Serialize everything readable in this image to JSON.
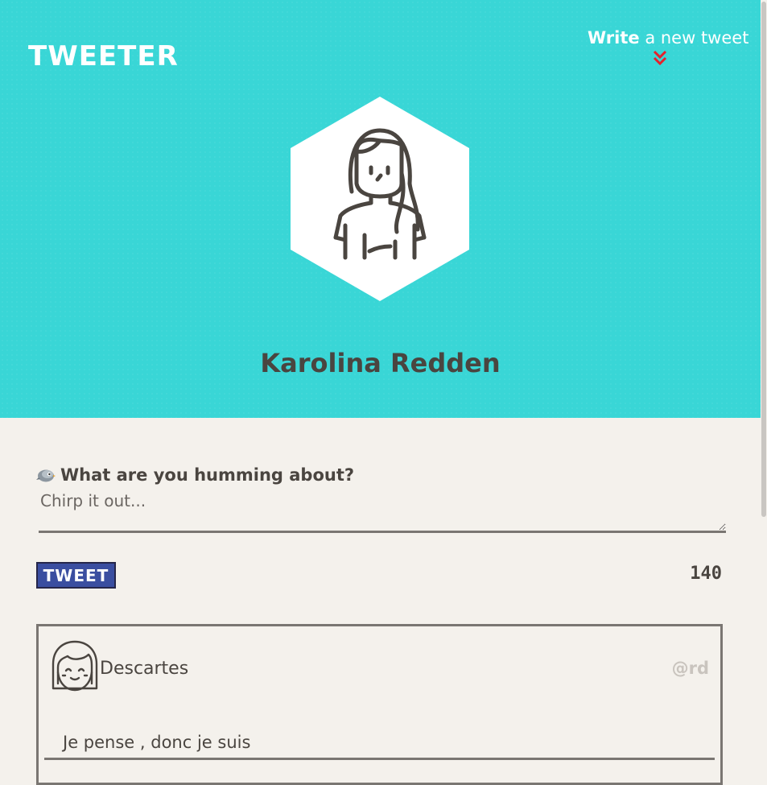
{
  "header": {
    "brand": "TWEETER",
    "compose_toggle": {
      "bold": "Write",
      "rest": " a new tweet",
      "icon": "double-chevron-down-icon"
    }
  },
  "profile": {
    "name": "Karolina Redden",
    "avatar_icon": "woman-avatar-icon"
  },
  "composer": {
    "prompt": "What are you humming about?",
    "prompt_icon": "bird-icon",
    "placeholder": "Chirp it out...",
    "value": "",
    "button_label": "TWEET",
    "counter": "140"
  },
  "tweets": [
    {
      "author": "Descartes",
      "handle": "@rd",
      "text": "Je pense , donc je suis",
      "avatar_icon": "girl-face-icon"
    }
  ],
  "colors": {
    "hero": "#39d6d6",
    "background": "#f4f1ec",
    "text": "#4a4540",
    "button": "#3a4ea0",
    "chevron": "#e5212c"
  }
}
